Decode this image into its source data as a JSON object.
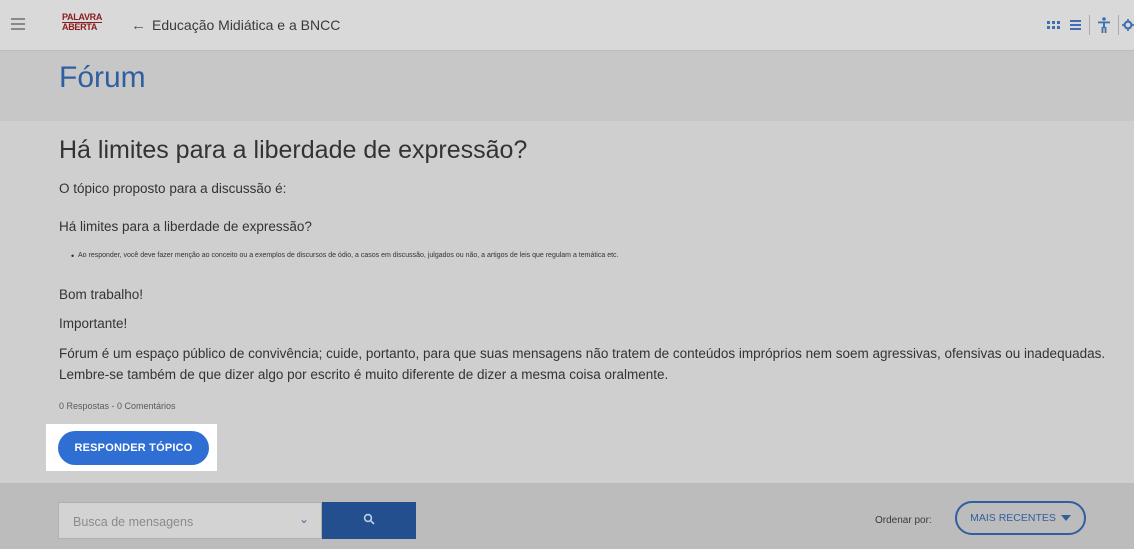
{
  "topbar": {
    "logo_line1": "PALAVRA",
    "logo_line2": "ABERTA",
    "back_arrow": "←",
    "breadcrumb": "Educação Midiática e a BNCC",
    "icons": [
      "grid-view-icon",
      "list-view-icon",
      "accessibility-icon",
      "settings-icon"
    ]
  },
  "page": {
    "title": "Fórum"
  },
  "topic": {
    "title": "Há limites para a liberdade de expressão?",
    "intro": "O tópico proposto para a discussão é:",
    "question": "Há limites para a liberdade de expressão?",
    "bullet": "Ao responder, você deve fazer menção ao conceito ou a exemplos de discursos de ódio, a casos em discussão, julgados ou não, a artigos de leis que regulam a temática etc.",
    "closing": "Bom trabalho!",
    "important": "Importante!",
    "notice_line1": "Fórum é um espaço público de convivência; cuide, portanto, para que suas mensagens não tratem de conteúdos impróprios nem soem agressivas, ofensivas ou inadequadas.",
    "notice_line2": "Lembre-se também de que dizer algo por escrito é muito diferente de dizer a mesma coisa oralmente.",
    "counts": "0 Respostas - 0 Comentários",
    "reply_button": "RESPONDER TÓPICO"
  },
  "search": {
    "placeholder": "Busca de mensagens",
    "chevron": "⌄",
    "button_icon": "search-icon"
  },
  "sort": {
    "label": "Ordenar por:",
    "value": "MAIS RECENTES"
  },
  "colors": {
    "accent": "#2f5fa0",
    "button": "#2f6fd4",
    "search_button": "#234f8e",
    "logo": "#8a1c1c"
  }
}
